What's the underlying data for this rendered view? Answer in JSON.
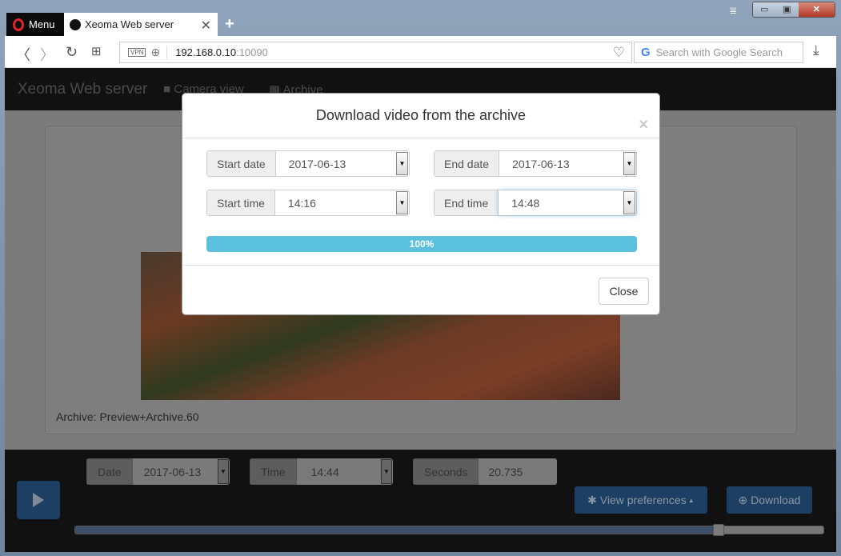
{
  "browser": {
    "menu_label": "Menu",
    "tab_title": "Xeoma Web server",
    "url_host": "192.168.0.10",
    "url_port": ":10090",
    "vpn_label": "VPN",
    "search_placeholder": "Search with Google Search"
  },
  "navbar": {
    "brand": "Xeoma Web server",
    "links": [
      "Camera view",
      "Archive"
    ]
  },
  "main": {
    "archive_label": "Archive: Preview+Archive.60"
  },
  "controls": {
    "date_label": "Date",
    "date_value": "2017-06-13",
    "time_label": "Time",
    "time_value": "14:44",
    "seconds_label": "Seconds",
    "seconds_value": "20.735",
    "view_prefs": "View preferences",
    "download": "Download",
    "timeline_position": 0.86
  },
  "modal": {
    "title": "Download video from the archive",
    "start_date_label": "Start date",
    "start_date": "2017-06-13",
    "end_date_label": "End date",
    "end_date": "2017-06-13",
    "start_time_label": "Start time",
    "start_time": "14:16",
    "end_time_label": "End time",
    "end_time": "14:48",
    "progress_text": "100%",
    "progress": 100,
    "close": "Close"
  },
  "colors": {
    "progress": "#5bc0de",
    "primary": "#337ab7"
  }
}
